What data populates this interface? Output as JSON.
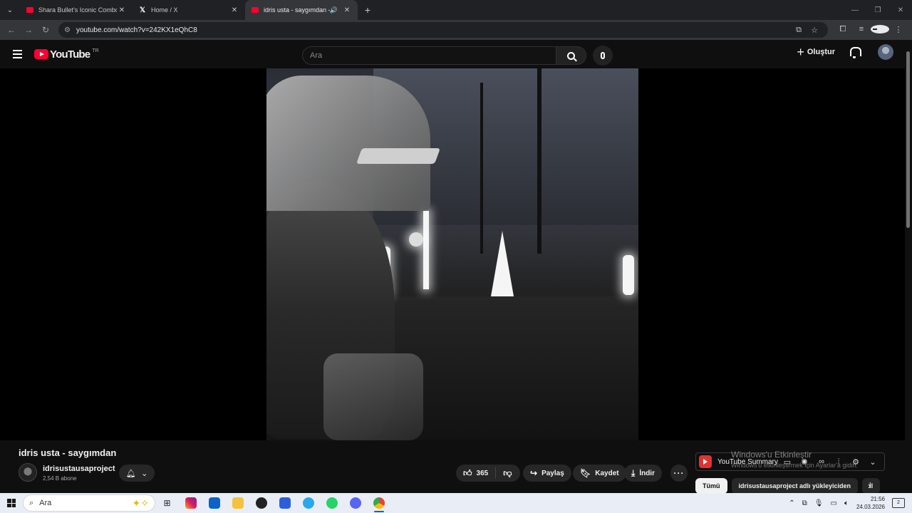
{
  "browser": {
    "tabs": [
      {
        "title": "Shara Bullet's Iconic Combo",
        "favicon": "youtube-favicon",
        "active": false
      },
      {
        "title": "Home / X",
        "favicon": "x-favicon",
        "active": false
      },
      {
        "title": "idris usta - saygımdan - You",
        "favicon": "youtube-favicon",
        "active": true,
        "audio": true
      }
    ],
    "url": "youtube.com/watch?v=242KX1eQhC8"
  },
  "youtube": {
    "logo_text": "YouTube",
    "country_code": "TR",
    "search_placeholder": "Ara",
    "create_label": "Oluştur"
  },
  "video": {
    "title": "idris usta - saygımdan",
    "channel": "idrisustausaproject",
    "subscribers": "2,54 B abone",
    "likes": "365",
    "share_label": "Paylaş",
    "save_label": "Kaydet",
    "download_label": "İndir"
  },
  "extension": {
    "name": "YouTube Summary"
  },
  "watermark": {
    "line1": "Windows'u Etkinleştir",
    "line2": "Windows'u etkinleştirmek için Ayarlar'a gidin."
  },
  "chips": [
    {
      "label": "Tümü",
      "active": true
    },
    {
      "label": "idrisustausaproject adlı yükleyiciden",
      "active": false
    },
    {
      "label": "İl",
      "active": false
    }
  ],
  "taskbar": {
    "search_placeholder": "Ara",
    "time": "21:56",
    "date": "24.03.2026",
    "notification_count": "2"
  },
  "colors": {
    "youtube_red": "#ff0033",
    "background": "#0f0f0f",
    "chip_bg": "#272727"
  }
}
